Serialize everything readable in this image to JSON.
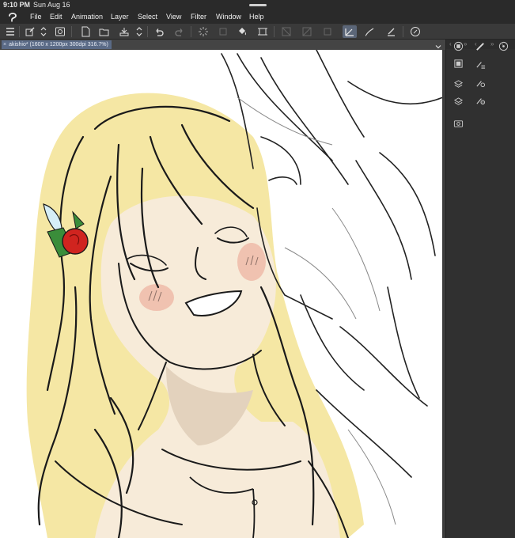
{
  "status": {
    "time": "9:10 PM",
    "date": "Sun Aug 16"
  },
  "menu": {
    "items": [
      "File",
      "Edit",
      "Animation",
      "Layer",
      "Select",
      "View",
      "Filter",
      "Window",
      "Help"
    ]
  },
  "tab": {
    "title": "akishio* (1600 x 1200px 300dpi 316.7%)",
    "close": "×"
  },
  "panel_header": {
    "left_arrow": "‹",
    "collapse_icon": "»",
    "right_arrow": "‹"
  },
  "colors": {
    "accent": "#5b6678",
    "tab_active": "#5a6a86",
    "hair": "#f5e7a4",
    "skin": "#f7ebd9",
    "blush": "#f0c2b0",
    "rose": "#d0241f"
  },
  "toolbar_icons": [
    "hamburger-menu-icon",
    "edit-canvas-icon",
    "stepper-icon",
    "snapshot-icon",
    "new-file-icon",
    "open-file-icon",
    "save-icon",
    "stepper-icon",
    "undo-icon",
    "redo-icon",
    "loading-spinner-icon",
    "clear-icon",
    "fill-icon",
    "transform-icon",
    "ruler-off-icon",
    "ruler-icon",
    "frame-icon",
    "pen-sub-tool-icon",
    "brush-sub-tool-icon",
    "eraser-sub-tool-icon",
    "quick-access-icon"
  ],
  "panel_icons": [
    "sub-tool-panel-icon",
    "pen-icon",
    "navigator-icon",
    "tool-property-icon",
    "add-layer-icon",
    "layer-property-icon",
    "layers-icon",
    "material-icon",
    "camera-icon"
  ]
}
